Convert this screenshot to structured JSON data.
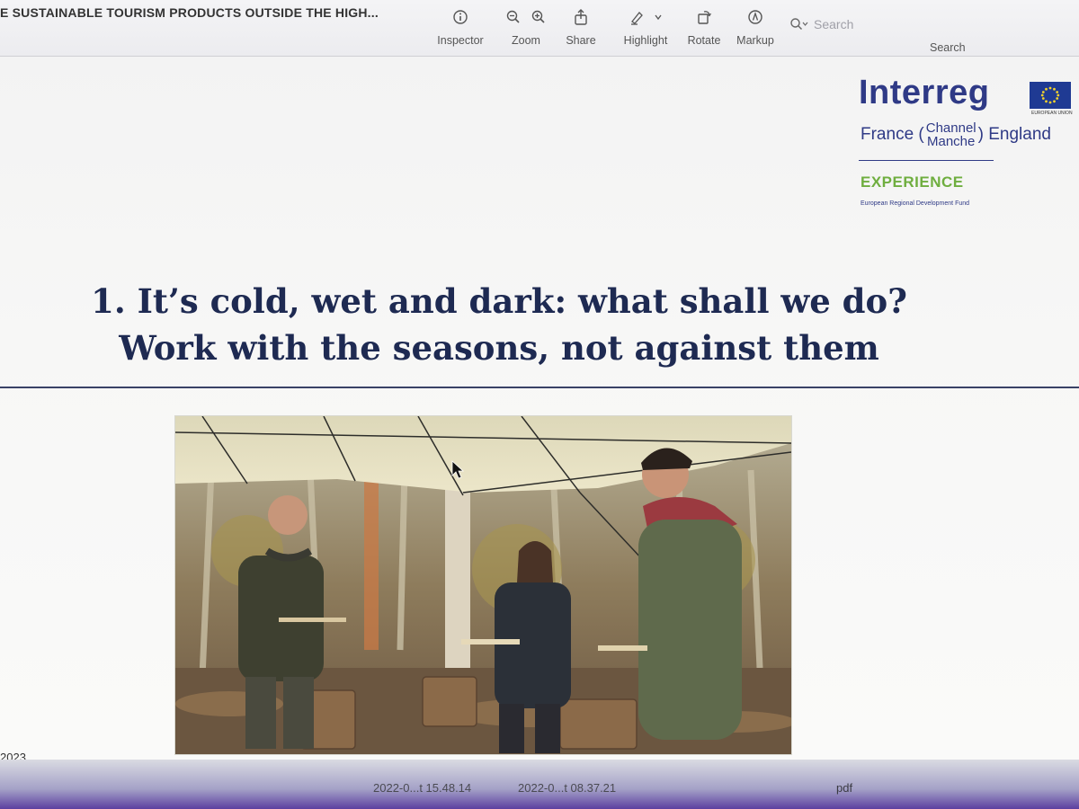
{
  "window": {
    "doc_title": "E SUSTAINABLE TOURISM PRODUCTS OUTSIDE THE HIGH..."
  },
  "toolbar": {
    "items": [
      {
        "label": "Inspector",
        "icon": "info-icon"
      },
      {
        "label": "Zoom",
        "icon": "zoom-icon"
      },
      {
        "label": "Share",
        "icon": "share-icon"
      },
      {
        "label": "Highlight",
        "icon": "highlight-icon"
      },
      {
        "label": "Rotate",
        "icon": "rotate-icon"
      },
      {
        "label": "Markup",
        "icon": "markup-icon"
      }
    ],
    "search_placeholder": "Search",
    "search_label": "Search"
  },
  "slide": {
    "logo": {
      "word": "Interreg",
      "eu_caption": "EUROPEAN UNION",
      "row_left": "France (",
      "row_stack_top": "Channel",
      "row_stack_bottom": "Manche",
      "row_right": ") England",
      "experience": "EXPERIENCE",
      "fund": "European Regional Development Fund",
      "colors": {
        "navy": "#2f3a86",
        "green": "#6fae3f"
      }
    },
    "heading_line1": "1. It’s cold, wet and dark: what shall we do?",
    "heading_line2": "Work with the seasons, not against them",
    "footer_year": "2023"
  },
  "dock": {
    "file1": "2022-0...t 15.48.14",
    "file2": "2022-0...t 08.37.21",
    "file3": "pdf"
  }
}
